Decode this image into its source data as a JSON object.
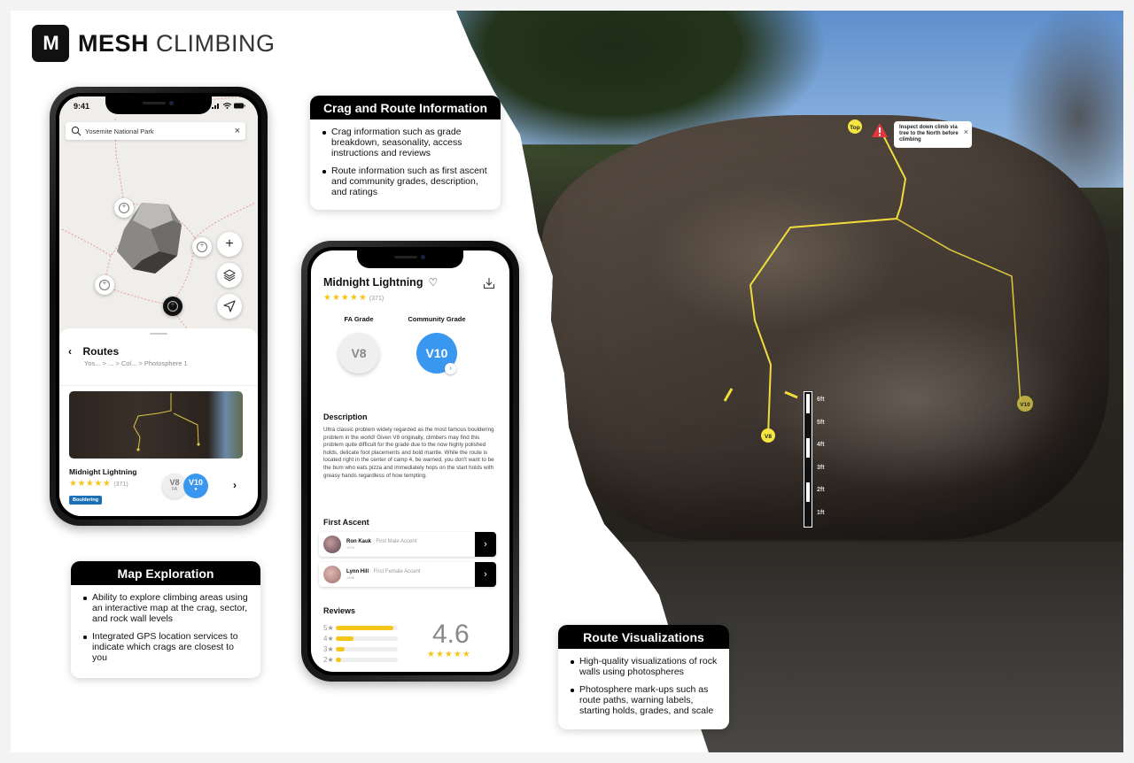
{
  "brand": {
    "logo_mark": "M",
    "name_bold": "MESH",
    "name_light": "CLIMBING"
  },
  "cards": {
    "crag_info": {
      "title": "Crag and Route Information",
      "bullets": [
        "Crag information such as grade breakdown, seasonality, access instructions and reviews",
        "Route information such as first ascent and community grades, description, and ratings"
      ]
    },
    "map_exploration": {
      "title": "Map Exploration",
      "bullets": [
        "Ability to explore climbing areas using an interactive map at the crag, sector, and rock wall levels",
        "Integrated GPS location services to indicate which crags are closest to you"
      ]
    },
    "route_viz": {
      "title": "Route Visualizations",
      "bullets": [
        "High-quality visualizations of rock walls using photospheres",
        "Photosphere mark-ups such as route paths, warning labels, starting holds, grades, and scale"
      ]
    }
  },
  "map_phone": {
    "status_time": "9:41",
    "search_value": "Yosemite National Park",
    "clear_glyph": "×",
    "zoom_in_glyph": "+",
    "sheet": {
      "back_glyph": "‹",
      "title": "Routes",
      "breadcrumb": "Yos... > ... > Col... > Photosphere 1"
    },
    "route": {
      "name": "Midnight Lightning",
      "stars": "★★★★★",
      "rating_count": "(371)",
      "tag": "Bouldering",
      "fa_grade": "V8",
      "fa_label": "FA",
      "community_grade": "V10",
      "community_icon": "●",
      "chevron": "›"
    }
  },
  "detail_phone": {
    "title": "Midnight Lightning",
    "heart_glyph": "♡",
    "stars": "★★★★★",
    "rating_count": "(371)",
    "fa_grade_label": "FA Grade",
    "community_grade_label": "Community Grade",
    "fa_grade": "V8",
    "community_grade": "V10",
    "grade_chevron": "›",
    "description_heading": "Description",
    "description": "Ultra classic problem widely regarded as the most famous bouldering problem in the world! Given V8 originally, climbers may find this problem quite difficult for the grade due to the now highly polished holds, delicate foot placements and bold mantle. While the route is located right in the center of camp 4, be warned, you don't want to be the bum who eats pizza and immediately hops on the start holds with greasy hands regardless of how tempting.",
    "first_ascent_heading": "First Ascent",
    "first_ascents": [
      {
        "name": "Ron Kauk",
        "role": " · First Male Accent",
        "year": "1978",
        "chevron": "›"
      },
      {
        "name": "Lynn Hill",
        "role": " · First Female Accent",
        "year": "1996",
        "chevron": "›"
      }
    ],
    "reviews_heading": "Reviews",
    "review_score": "4.6",
    "review_stars": "★★★★★",
    "review_breakdown": [
      {
        "stars": "5★",
        "fraction": 0.93
      },
      {
        "stars": "4★",
        "fraction": 0.28
      },
      {
        "stars": "3★",
        "fraction": 0.14
      },
      {
        "stars": "2★",
        "fraction": 0.08
      }
    ]
  },
  "photosphere": {
    "top_label": "Top",
    "warning_text": "Inspect down climb via tree to the North before climbing",
    "warning_close": "×",
    "start_labels": [
      "V8",
      "V10"
    ],
    "scale_labels": [
      "6ft",
      "5ft",
      "4ft",
      "3ft",
      "2ft",
      "1ft"
    ],
    "route_color": "#f0dc3c"
  },
  "colors": {
    "accent_blue": "#3a97f0",
    "star_gold": "#f5c518",
    "tag_blue": "#1a6fb5"
  }
}
